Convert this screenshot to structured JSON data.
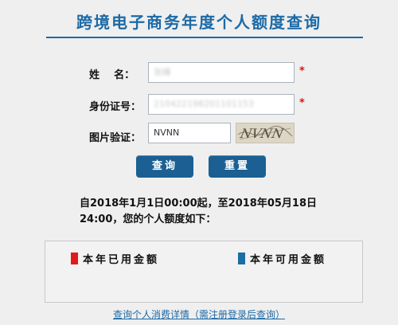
{
  "page": {
    "title": "跨境电子商务年度个人额度查询"
  },
  "form": {
    "name": {
      "label": "姓    名：",
      "value": "张峰",
      "required_mark": "*"
    },
    "id_number": {
      "label": "身份证号：",
      "value": "210422198201101153",
      "required_mark": "*"
    },
    "captcha": {
      "label": "图片验证：",
      "value": "NVNN",
      "image_text": "NVNN"
    }
  },
  "buttons": {
    "query": "查询",
    "reset": "重置"
  },
  "result": {
    "note": "自2018年1月1日00:00起，至2018年05月18日24:00，您的个人额度如下："
  },
  "legend": {
    "used": {
      "label": "本年已用金额",
      "color": "#e21a1a"
    },
    "available": {
      "label": "本年可用金额",
      "color": "#1b6da3"
    }
  },
  "footer": {
    "link": "查询个人消费详情（需注册登录后查询）"
  },
  "colors": {
    "accent": "#1c6aa6",
    "button": "#1b5f93",
    "required": "#d0161b"
  }
}
